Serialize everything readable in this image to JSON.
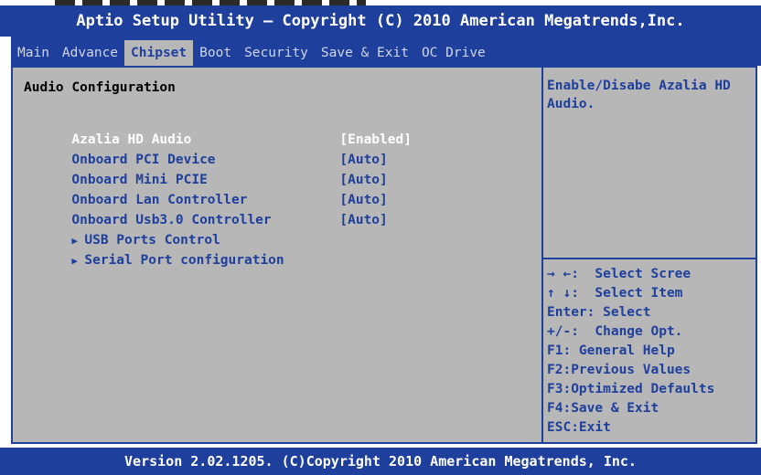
{
  "title": "Aptio Setup Utility – Copyright (C) 2010 American Megatrends,Inc.",
  "tabs": [
    {
      "label": "Main"
    },
    {
      "label": "Advance"
    },
    {
      "label": "Chipset",
      "active": true
    },
    {
      "label": "Boot"
    },
    {
      "label": "Security"
    },
    {
      "label": "Save & Exit"
    },
    {
      "label": "OC Drive"
    }
  ],
  "section_title": "Audio Configuration",
  "items": [
    {
      "label": "Azalia HD Audio",
      "value": "[Enabled]",
      "selected": true
    },
    {
      "label": "Onboard PCI Device",
      "value": "[Auto]"
    },
    {
      "label": "Onboard Mini PCIE",
      "value": "[Auto]"
    },
    {
      "label": "Onboard Lan Controller",
      "value": "[Auto]"
    },
    {
      "label": "Onboard Usb3.0 Controller",
      "value": "[Auto]"
    }
  ],
  "submenus": [
    {
      "label": "USB Ports Control",
      "icon": "triangle-right-icon"
    },
    {
      "label": "Serial Port configuration",
      "icon": "triangle-right-icon"
    }
  ],
  "help_text": "Enable/Disabe Azalia HD Audio.",
  "keys": [
    "→ ←:  Select Scree",
    "↑ ↓:  Select Item",
    "Enter: Select",
    "+/-:  Change Opt.",
    "F1: General Help",
    "F2:Previous Values",
    "F3:Optimized Defaults",
    "F4:Save & Exit",
    "ESC:Exit"
  ],
  "footer": "Version 2.02.1205. (C)Copyright 2010 American Megatrends, Inc.",
  "colors": {
    "frame": "#1f3f9c",
    "panel": "#b7b7b7",
    "selected_text": "#ffffff"
  }
}
